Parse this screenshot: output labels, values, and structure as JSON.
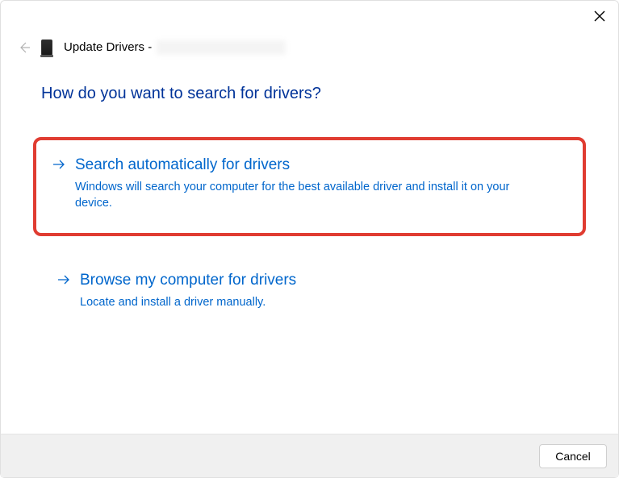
{
  "header": {
    "title_prefix": "Update Drivers -"
  },
  "question": "How do you want to search for drivers?",
  "options": [
    {
      "title": "Search automatically for drivers",
      "description": "Windows will search your computer for the best available driver and install it on your device."
    },
    {
      "title": "Browse my computer for drivers",
      "description": "Locate and install a driver manually."
    }
  ],
  "footer": {
    "cancel_label": "Cancel"
  }
}
